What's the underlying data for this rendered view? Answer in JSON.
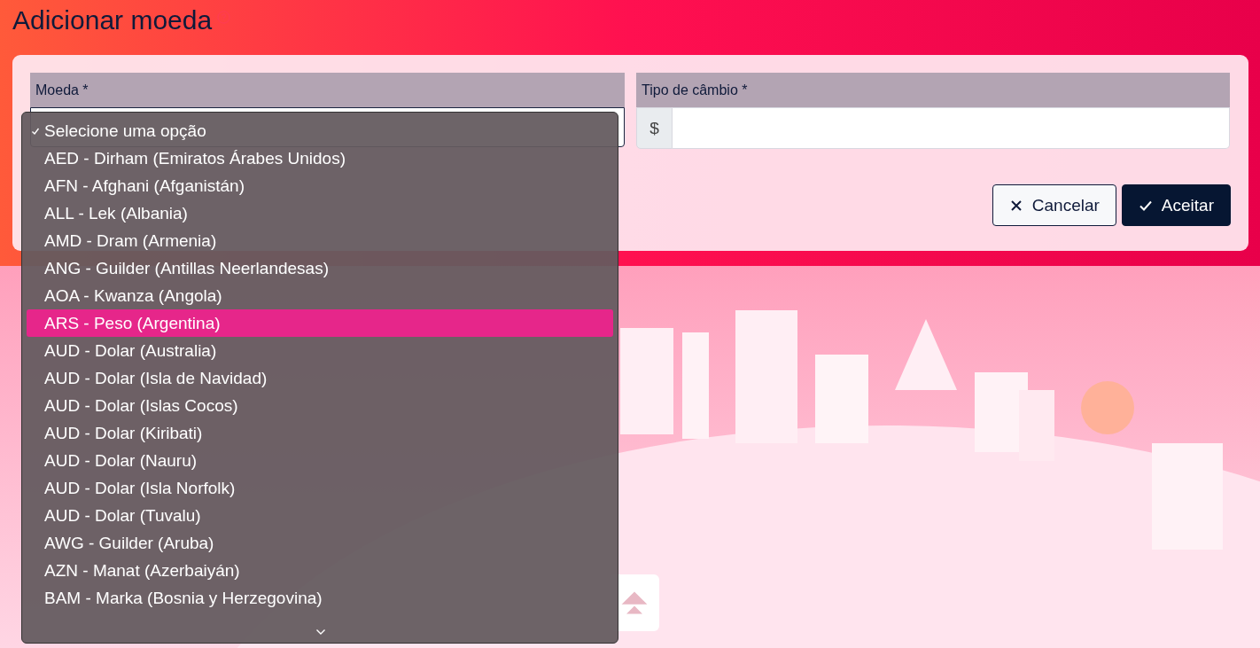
{
  "page": {
    "title": "Adicionar moeda"
  },
  "form": {
    "fields": [
      {
        "label": "Moeda *",
        "kind": "select"
      },
      {
        "label": "Tipo de câmbio *",
        "kind": "money",
        "prefix": "$"
      }
    ],
    "buttons": [
      {
        "label": "Cancelar",
        "kind": "secondary"
      },
      {
        "label": "Aceitar",
        "kind": "primary"
      }
    ]
  },
  "dropdown": {
    "options": [
      {
        "label": "Selecione uma opção",
        "selected": true,
        "highlighted": false
      },
      {
        "label": "AED - Dirham (Emiratos Árabes Unidos)",
        "selected": false,
        "highlighted": false
      },
      {
        "label": "AFN - Afghani (Afganistán)",
        "selected": false,
        "highlighted": false
      },
      {
        "label": "ALL - Lek (Albania)",
        "selected": false,
        "highlighted": false
      },
      {
        "label": "AMD - Dram (Armenia)",
        "selected": false,
        "highlighted": false
      },
      {
        "label": "ANG - Guilder (Antillas Neerlandesas)",
        "selected": false,
        "highlighted": false
      },
      {
        "label": "AOA - Kwanza (Angola)",
        "selected": false,
        "highlighted": false
      },
      {
        "label": "ARS - Peso (Argentina)",
        "selected": false,
        "highlighted": true
      },
      {
        "label": "AUD - Dolar (Australia)",
        "selected": false,
        "highlighted": false
      },
      {
        "label": "AUD - Dolar (Isla de Navidad)",
        "selected": false,
        "highlighted": false
      },
      {
        "label": "AUD - Dolar (Islas Cocos)",
        "selected": false,
        "highlighted": false
      },
      {
        "label": "AUD - Dolar (Kiribati)",
        "selected": false,
        "highlighted": false
      },
      {
        "label": "AUD - Dolar (Nauru)",
        "selected": false,
        "highlighted": false
      },
      {
        "label": "AUD - Dolar (Isla Norfolk)",
        "selected": false,
        "highlighted": false
      },
      {
        "label": "AUD - Dolar (Tuvalu)",
        "selected": false,
        "highlighted": false
      },
      {
        "label": "AWG - Guilder (Aruba)",
        "selected": false,
        "highlighted": false
      },
      {
        "label": "AZN - Manat (Azerbaiyán)",
        "selected": false,
        "highlighted": false
      },
      {
        "label": "BAM - Marka (Bosnia y Herzegovina)",
        "selected": false,
        "highlighted": false
      }
    ]
  }
}
